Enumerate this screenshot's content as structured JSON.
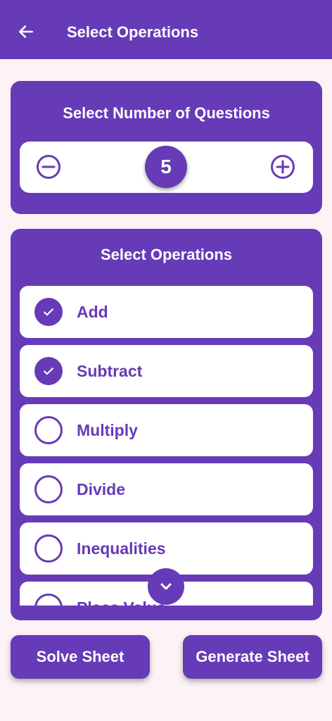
{
  "appbar": {
    "title": "Select Operations",
    "back_icon": "arrow-left-icon"
  },
  "questions_card": {
    "title": "Select Number of Questions",
    "count": "5",
    "decrement_icon": "minus-circle-icon",
    "increment_icon": "plus-circle-icon"
  },
  "operations_card": {
    "title": "Select Operations",
    "items": [
      {
        "label": "Add",
        "checked": true
      },
      {
        "label": "Subtract",
        "checked": true
      },
      {
        "label": "Multiply",
        "checked": false
      },
      {
        "label": "Divide",
        "checked": false
      },
      {
        "label": "Inequalities",
        "checked": false
      },
      {
        "label": "Place Value",
        "checked": false
      }
    ],
    "scroll_icon": "chevron-down-icon"
  },
  "actions": {
    "solve_label": "Solve Sheet",
    "generate_label": "Generate Sheet"
  },
  "colors": {
    "primary": "#673ab7",
    "background": "#fdf3f6"
  }
}
